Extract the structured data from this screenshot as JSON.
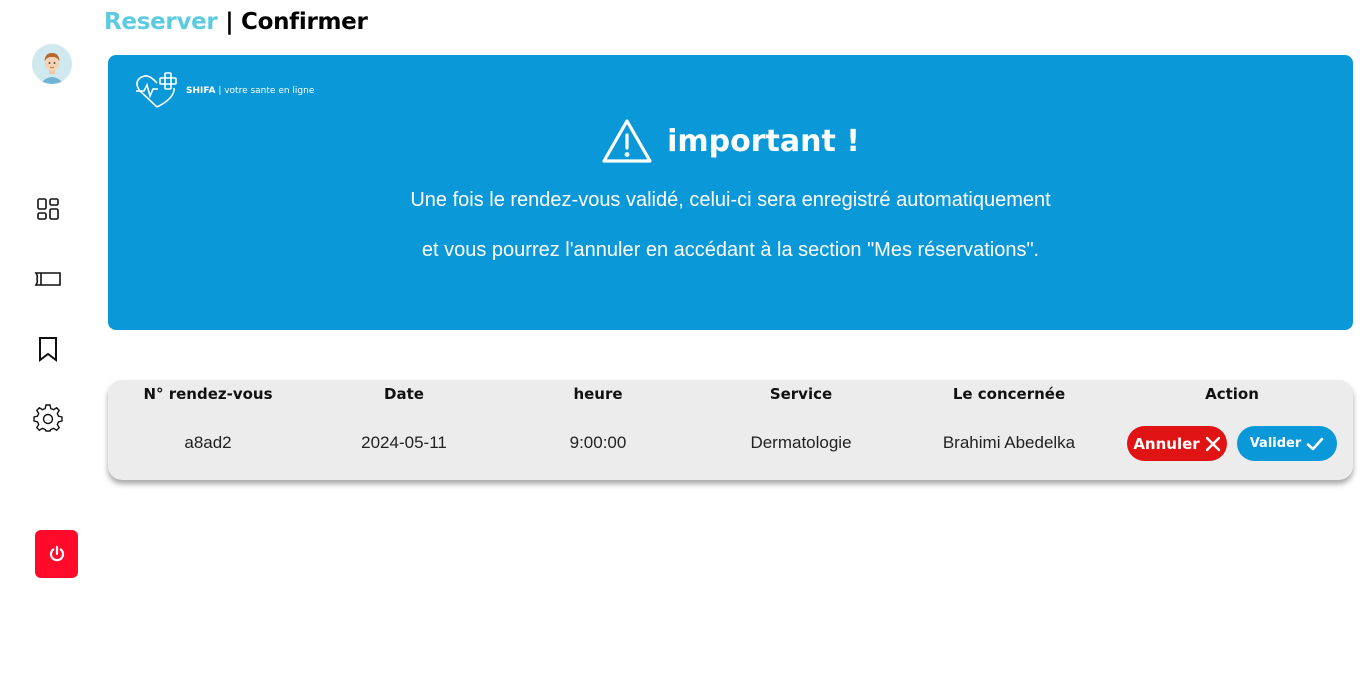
{
  "breadcrumb": {
    "link": "Reserver",
    "separator": " | ",
    "current": "Confirmer"
  },
  "sidebar": {
    "items": [
      {
        "icon": "dashboard-icon"
      },
      {
        "icon": "ticket-icon"
      },
      {
        "icon": "bookmark-icon"
      },
      {
        "icon": "gear-icon"
      }
    ],
    "logout_icon": "power-icon",
    "logout_color": "#ff0a2a"
  },
  "banner": {
    "brand_name": "SHIFA",
    "brand_tagline": "| votre sante en ligne",
    "warning_title": "important !",
    "line1": "Une fois le rendez-vous validé, celui-ci sera enregistré automatiquement",
    "line2": "et vous pourrez l'annuler en accédant à la section \"Mes réservations\".",
    "background": "#0a98d8"
  },
  "table": {
    "headers": [
      "N° rendez-vous",
      "Date",
      "heure",
      "Service",
      "Le concernée",
      "Action"
    ],
    "row": {
      "id": "a8ad2",
      "date": "2024-05-11",
      "heure": "9:00:00",
      "service": "Dermatologie",
      "concernee": "Brahimi Abedelka"
    },
    "cancel_label": "Annuler",
    "validate_label": "Valider",
    "cancel_color": "#e01414",
    "validate_color": "#0a98d8"
  },
  "colors": {
    "accent": "#5ccbe0"
  }
}
